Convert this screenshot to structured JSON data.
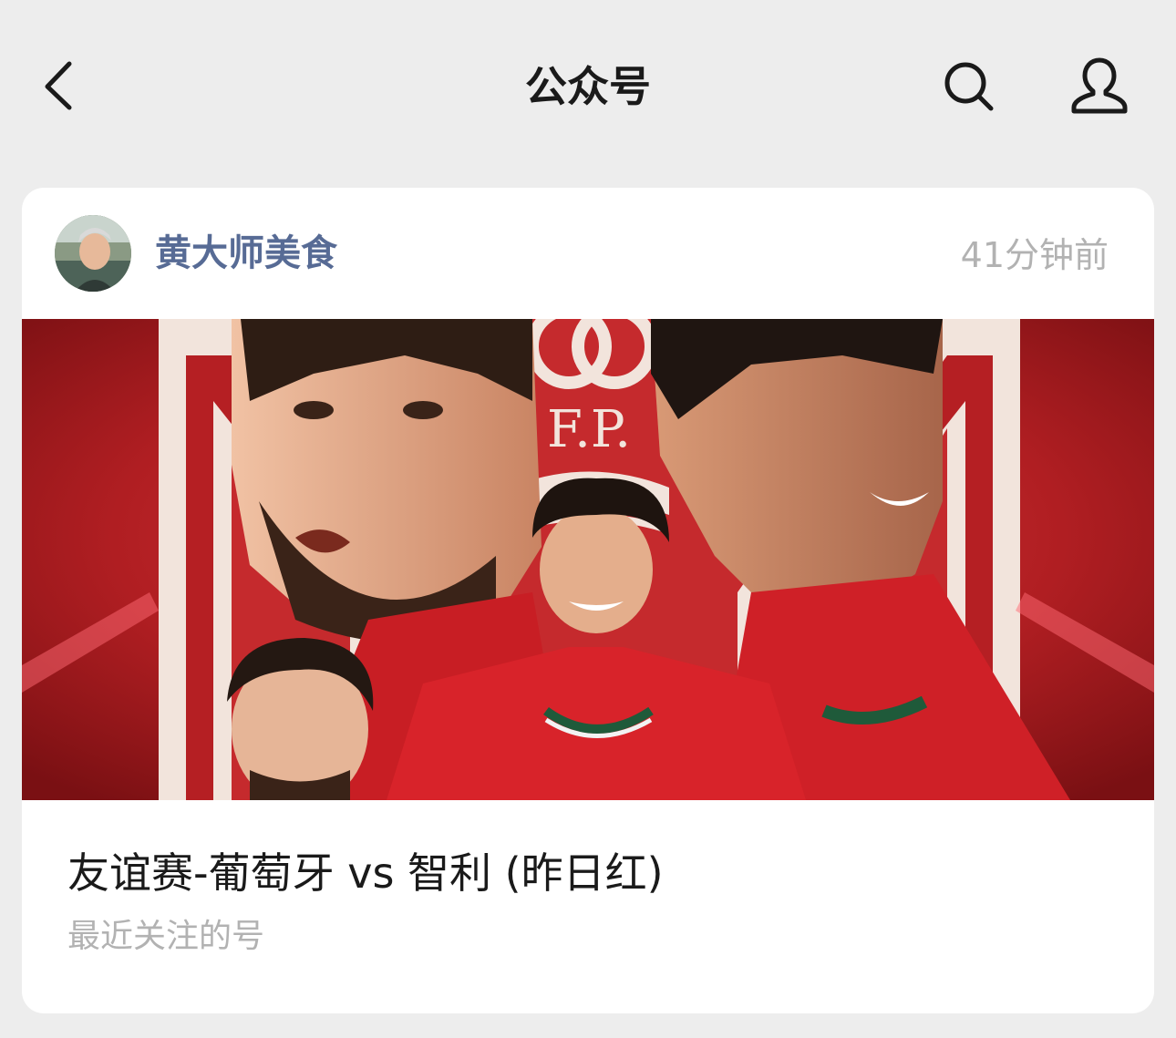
{
  "header": {
    "title": "公众号",
    "back_icon": "chevron-left-icon",
    "search_icon": "search-icon",
    "profile_icon": "user-icon"
  },
  "post": {
    "account_name": "黄大师美食",
    "time": "41分钟前",
    "cover_badge": "F.P.",
    "title": "友谊赛-葡萄牙 vs 智利 (昨日红)",
    "subtitle": "最近关注的号"
  },
  "colors": {
    "background": "#ededed",
    "card": "#ffffff",
    "account_name": "#576b95",
    "muted": "#b2b2b2",
    "cover_red": "#b01e22"
  }
}
